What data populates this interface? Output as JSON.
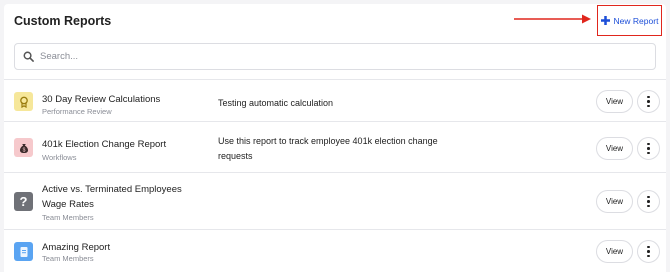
{
  "header": {
    "title": "Custom Reports",
    "new_report_label": "New Report",
    "accent_color": "#1d4fd8",
    "highlight_color": "#e0261d"
  },
  "search": {
    "placeholder": "Search..."
  },
  "reports": [
    {
      "name": "30 Day Review Calculations",
      "category": "Performance Review",
      "description": "Testing automatic calculation",
      "icon": "award-icon",
      "icon_color": "#f6e79a",
      "view_label": "View"
    },
    {
      "name": "401k Election Change Report",
      "category": "Workflows",
      "description": "Use this report to track employee 401k election change requests",
      "icon": "money-bag-icon",
      "icon_color": "#f6c9cc",
      "view_label": "View"
    },
    {
      "name": "Active vs. Terminated Employees Wage Rates",
      "category": "Team Members",
      "description": "",
      "icon": "question-icon",
      "icon_color": "#6f7177",
      "view_label": "View"
    },
    {
      "name": "Amazing Report",
      "category": "Team Members",
      "description": "",
      "icon": "document-icon",
      "icon_color": "#5aa4f2",
      "view_label": "View"
    }
  ]
}
